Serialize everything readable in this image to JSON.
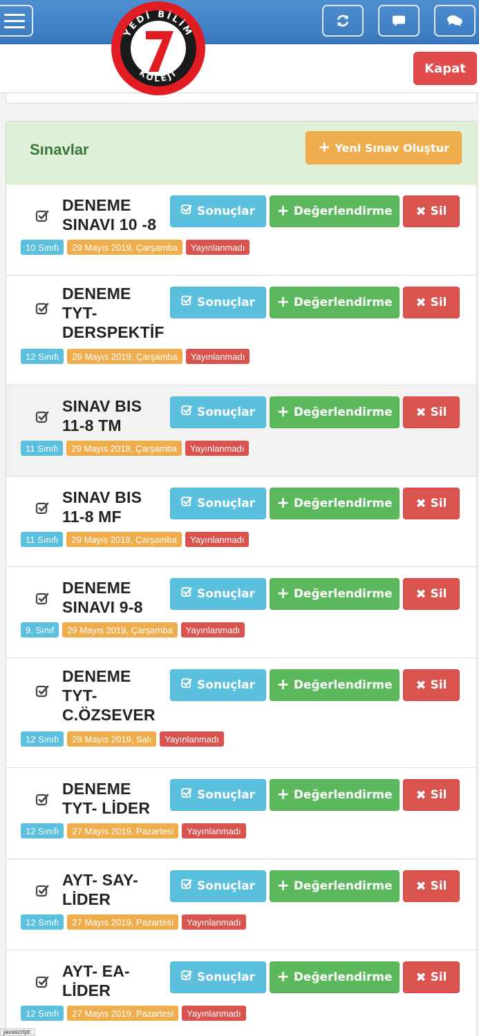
{
  "header": {
    "logo_text_top": "YEDİ BİLİM",
    "logo_number": "7",
    "logo_text_bottom": "KOLEJİ",
    "icons": [
      "menu-icon",
      "refresh-icon",
      "comment-icon",
      "comments-icon"
    ]
  },
  "subheader": {
    "close_label": "Kapat"
  },
  "panel": {
    "title": "Sınavlar",
    "new_exam_label": "Yeni Sınav Oluştur"
  },
  "actions": {
    "results_label": "Sonuçlar",
    "evaluate_label": "Değerlendirme",
    "delete_label": "Sil"
  },
  "exams": [
    {
      "name": "DENEME SINAVI 10 -8",
      "lines": [
        "DENEME",
        "SINAVI 10 -8"
      ],
      "grade": "10 Sınıfı",
      "date": "29 Mayıs 2019, Çarşamba",
      "status": "Yayınlanmadı"
    },
    {
      "name": "DENEME TYT-DERSPEKTİF",
      "lines": [
        "DENEME",
        "TYT-",
        "DERSPEKTİF"
      ],
      "grade": "12 Sınıfı",
      "date": "29 Mayıs 2019, Çarşamba",
      "status": "Yayınlanmadı"
    },
    {
      "name": "SINAV BIS 11-8 TM",
      "lines": [
        "SINAV BIS",
        "11-8 TM"
      ],
      "grade": "11 Sınıfı",
      "date": "29 Mayıs 2019, Çarşamba",
      "status": "Yayınlanmadı"
    },
    {
      "name": "SINAV BIS 11-8 MF",
      "lines": [
        "SINAV BIS",
        "11-8 MF"
      ],
      "grade": "11 Sınıfı",
      "date": "29 Mayıs 2019, Çarşamba",
      "status": "Yayınlanmadı"
    },
    {
      "name": "DENEME SINAVI 9-8",
      "lines": [
        "DENEME",
        "SINAVI 9-8"
      ],
      "grade": "9. Sınıf",
      "date": "29 Mayıs 2019, Çarşamba",
      "status": "Yayınlanmadı"
    },
    {
      "name": "DENEME TYT-C.ÖZSEVER",
      "lines": [
        "DENEME",
        "TYT-",
        "C.ÖZSEVER"
      ],
      "grade": "12 Sınıfı",
      "date": "28 Mayıs 2019, Salı",
      "status": "Yayınlanmadı"
    },
    {
      "name": "DENEME TYT- LİDER",
      "lines": [
        "DENEME",
        "TYT- LİDER"
      ],
      "grade": "12 Sınıfı",
      "date": "27 Mayıs 2019, Pazartesi",
      "status": "Yayınlanmadı"
    },
    {
      "name": "AYT- SAY- LİDER",
      "lines": [
        "AYT- SAY-",
        "LİDER"
      ],
      "grade": "12 Sınıfı",
      "date": "27 Mayıs 2019, Pazartesi",
      "status": "Yayınlanmadı"
    },
    {
      "name": "AYT- EA- LİDER",
      "lines": [
        "AYT- EA-",
        "LİDER"
      ],
      "grade": "12 Sınıfı",
      "date": "27 Mayıs 2019, Pazartesi",
      "status": "Yayınlanmadı"
    }
  ],
  "status_bar": {
    "text": "javascript:"
  },
  "colors": {
    "navbar": "#3a78bf",
    "panel_heading": "#dff0d8",
    "info": "#5bc0de",
    "success": "#5cb85c",
    "danger": "#d9534f",
    "warning": "#f0ad4e"
  }
}
